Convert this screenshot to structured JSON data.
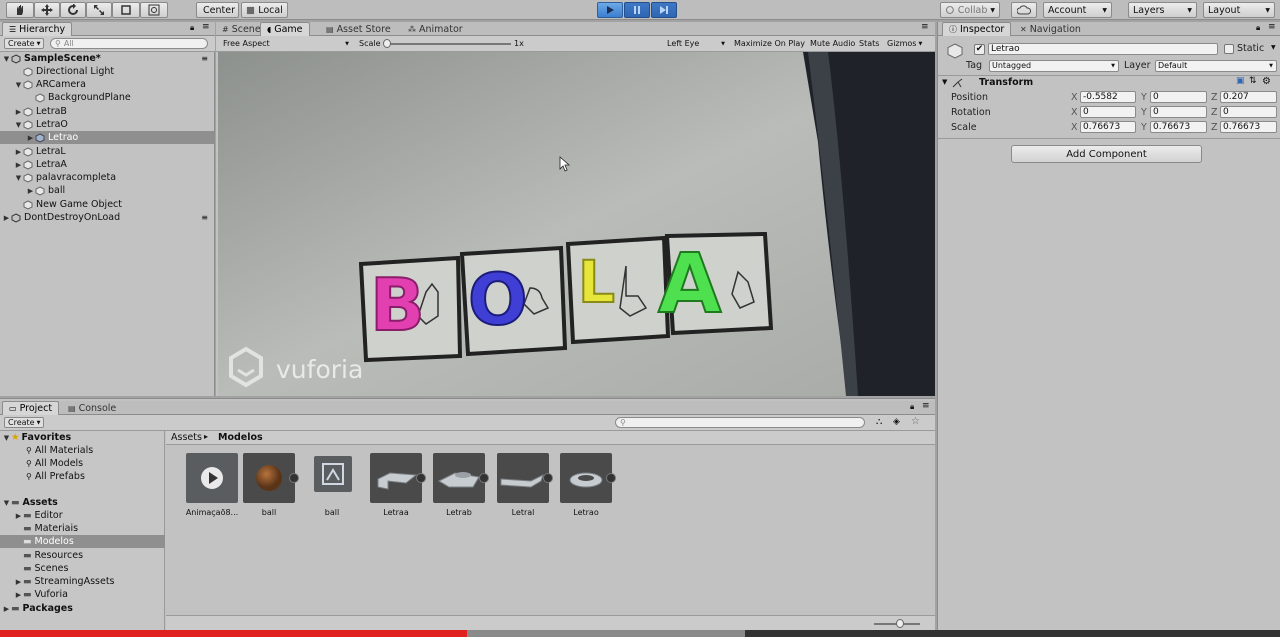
{
  "toolbar": {
    "pivot_label": "Center",
    "space_label": "Local",
    "collab_label": "Collab",
    "account_label": "Account",
    "layers_label": "Layers",
    "layout_label": "Layout"
  },
  "hierarchy": {
    "tab_label": "Hierarchy",
    "create_label": "Create",
    "search_placeholder": "All",
    "items": [
      {
        "label": "SampleScene*"
      },
      {
        "label": "Directional Light"
      },
      {
        "label": "ARCamera"
      },
      {
        "label": "BackgroundPlane"
      },
      {
        "label": "LetraB"
      },
      {
        "label": "LetraO"
      },
      {
        "label": "Letrao"
      },
      {
        "label": "LetraL"
      },
      {
        "label": "LetraA"
      },
      {
        "label": "palavracompleta"
      },
      {
        "label": "ball"
      },
      {
        "label": "New Game Object"
      },
      {
        "label": "DontDestroyOnLoad"
      }
    ]
  },
  "center_tabs": [
    {
      "label": "Scene"
    },
    {
      "label": "Game"
    },
    {
      "label": "Asset Store"
    },
    {
      "label": "Animator"
    }
  ],
  "game_bar": {
    "aspect": "Free Aspect",
    "scale_label": "Scale",
    "scale_value": "1x",
    "display": "Left Eye",
    "maximize": "Maximize On Play",
    "mute": "Mute Audio",
    "stats": "Stats",
    "gizmos": "Gizmos"
  },
  "game_view": {
    "letters": [
      "B",
      "O",
      "L",
      "A"
    ],
    "watermark": "vuforia"
  },
  "inspector": {
    "tabs": [
      {
        "label": "Inspector"
      },
      {
        "label": "Navigation"
      }
    ],
    "object_name": "Letrao",
    "static_label": "Static",
    "tag_label": "Tag",
    "tag_value": "Untagged",
    "layer_label": "Layer",
    "layer_value": "Default",
    "component_title": "Transform",
    "rows": [
      {
        "label": "Position",
        "x": "-0.5582",
        "y": "0",
        "z": "0.207"
      },
      {
        "label": "Rotation",
        "x": "0",
        "y": "0",
        "z": "0"
      },
      {
        "label": "Scale",
        "x": "0.76673",
        "y": "0.76673",
        "z": "0.76673"
      }
    ],
    "axis_x": "X",
    "axis_y": "Y",
    "axis_z": "Z",
    "add_component": "Add Component"
  },
  "project": {
    "tabs": [
      {
        "label": "Project"
      },
      {
        "label": "Console"
      }
    ],
    "create_label": "Create",
    "favorites": {
      "label": "Favorites",
      "items": [
        {
          "label": "All Materials"
        },
        {
          "label": "All Models"
        },
        {
          "label": "All Prefabs"
        }
      ]
    },
    "assets": {
      "label": "Assets",
      "items": [
        {
          "label": "Editor"
        },
        {
          "label": "Materiais"
        },
        {
          "label": "Modelos"
        },
        {
          "label": "Resources"
        },
        {
          "label": "Scenes"
        },
        {
          "label": "StreamingAssets"
        },
        {
          "label": "Vuforia"
        }
      ]
    },
    "packages_label": "Packages",
    "breadcrumb_root": "Assets",
    "breadcrumb_current": "Modelos",
    "asset_items": [
      {
        "label": "Animaçaõ8...",
        "kind": "animation-icon"
      },
      {
        "label": "ball",
        "kind": "sphere-icon"
      },
      {
        "label": "ball",
        "kind": "prefab-icon"
      },
      {
        "label": "Letraa",
        "kind": "mesh-icon"
      },
      {
        "label": "Letrab",
        "kind": "mesh-icon"
      },
      {
        "label": "Letral",
        "kind": "mesh-icon"
      },
      {
        "label": "Letrao",
        "kind": "mesh-icon"
      }
    ]
  },
  "video_progress": 0.365,
  "colors": {
    "accent_play": "#3b7ed0",
    "letter_b": "#e23fb0",
    "letter_o": "#3f3fd6",
    "letter_l": "#e6e63a",
    "letter_a": "#4fe04f",
    "progress": "#e02020"
  }
}
